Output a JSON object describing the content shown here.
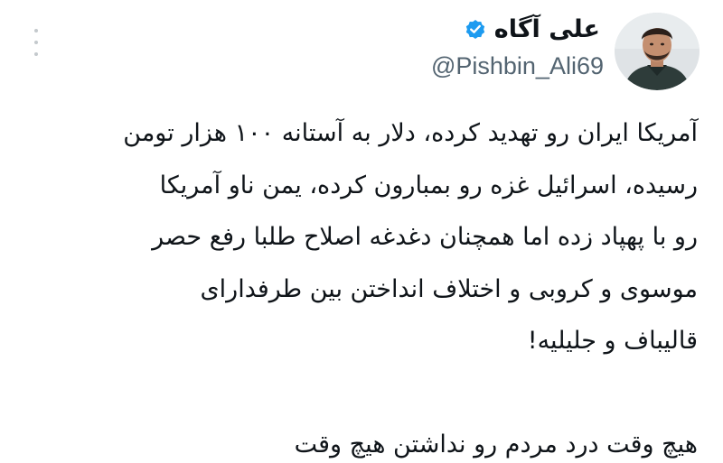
{
  "author": {
    "display_name": "علی آگاه",
    "handle": "@Pishbin_Ali69",
    "verified": true,
    "verified_color": "#1d9bf0"
  },
  "actions": {
    "more_icon": "more-vertical-icon"
  },
  "tweet": {
    "paragraph_1": [
      "آمریکا ایران رو تهدید کرده، دلار به آستانه ۱۰۰ هزار تومن",
      "رسیده، اسرائیل غزه رو بمبارون کرده، یمن ناو آمریکا",
      "رو با پهپاد زده اما همچنان دغدغه اصلاح طلبا رفع حصر",
      "موسوی و کروبی و اختلاف انداختن بین طرفدارای",
      "قالیباف و جلیلیه!"
    ],
    "paragraph_2": [
      "هیچ وقت درد مردم رو نداشتن هیچ وقت"
    ]
  },
  "colors": {
    "text": "#0f1419",
    "secondary_text": "#536471",
    "background": "#ffffff"
  }
}
